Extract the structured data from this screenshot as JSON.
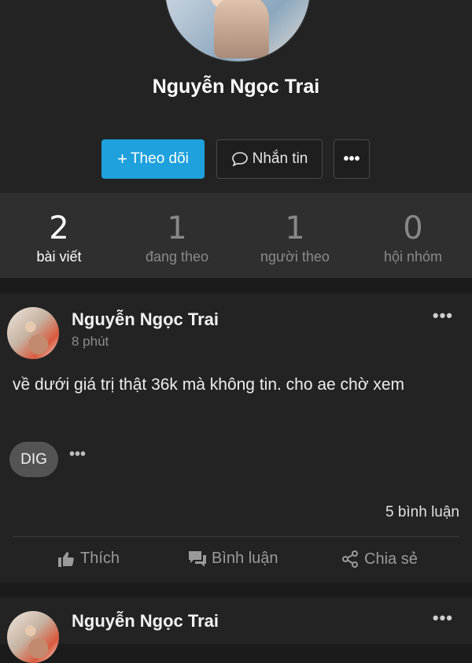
{
  "profile": {
    "name": "Nguyễn Ngọc Trai",
    "follow_label": "Theo dõi",
    "message_label": "Nhắn tin",
    "more_label": "•••"
  },
  "stats": [
    {
      "value": "2",
      "label": "bài viết"
    },
    {
      "value": "1",
      "label": "đang theo"
    },
    {
      "value": "1",
      "label": "người theo"
    },
    {
      "value": "0",
      "label": "hội nhóm"
    }
  ],
  "posts": [
    {
      "author": "Nguyễn Ngọc Trai",
      "time": "8 phút",
      "text": "về dưới giá trị thật 36k mà không tin. cho ae chờ xem",
      "tag": "DIG",
      "comments": "5 bình luận",
      "actions": {
        "like": "Thích",
        "comment": "Bình luận",
        "share": "Chia sẻ"
      }
    },
    {
      "author": "Nguyễn Ngọc Trai"
    }
  ],
  "colors": {
    "accent": "#1ea1dd",
    "background": "#1b1b1b",
    "card": "#232323"
  }
}
